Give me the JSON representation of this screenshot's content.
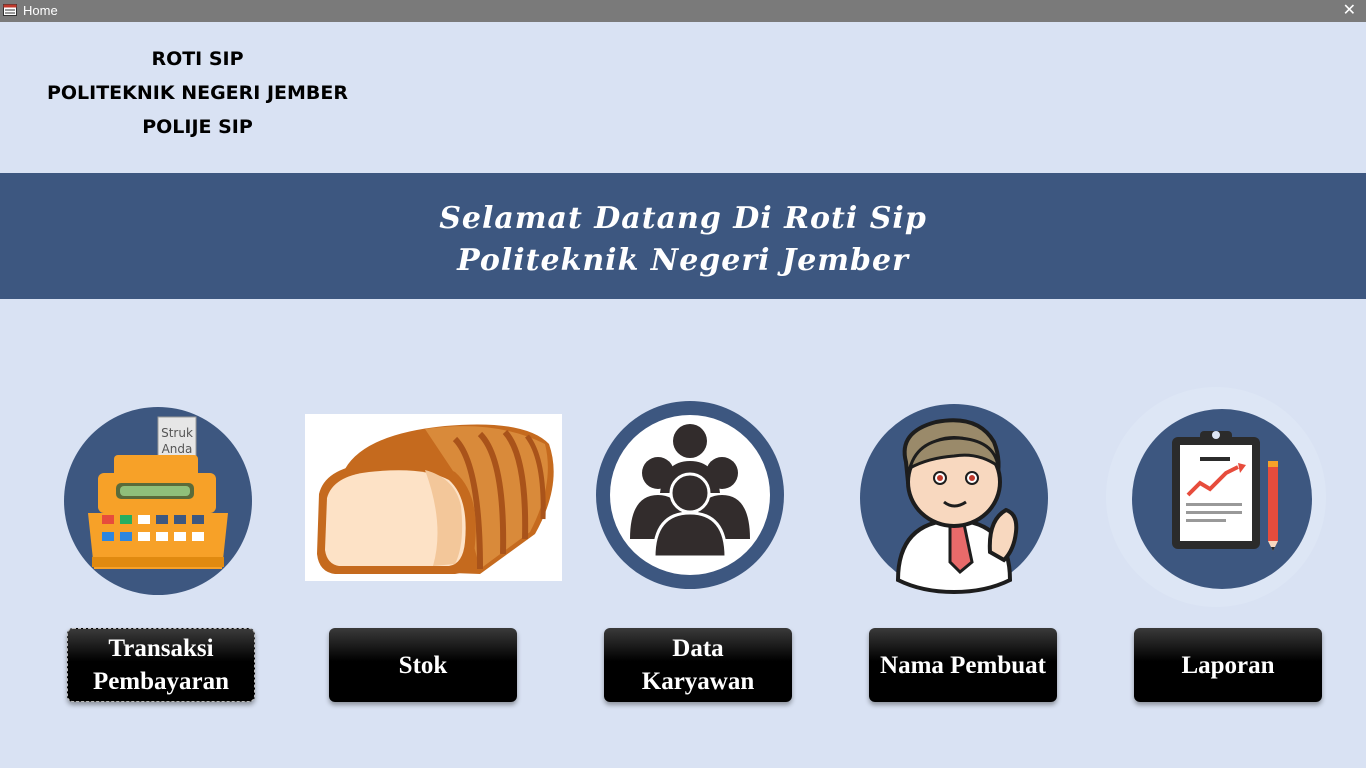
{
  "window": {
    "title": "Home",
    "close_glyph": "✕"
  },
  "org": {
    "line1": "ROTI SIP",
    "line2": "POLITEKNIK NEGERI JEMBER",
    "line3": "POLIJE SIP"
  },
  "banner": {
    "line1": "Selamat Datang Di Roti Sip",
    "line2": "Politeknik Negeri Jember"
  },
  "icons": {
    "register_text1": "Struk",
    "register_text2": "Anda"
  },
  "buttons": {
    "transaksi": [
      "Transaksi",
      "Pembayaran"
    ],
    "stok": "Stok",
    "karyawan": [
      "Data",
      "Karyawan"
    ],
    "pembuat": "Nama Pembuat",
    "laporan": "Laporan"
  },
  "colors": {
    "background": "#d9e2f3",
    "banner": "#3d5780",
    "circle": "#3d5780"
  }
}
